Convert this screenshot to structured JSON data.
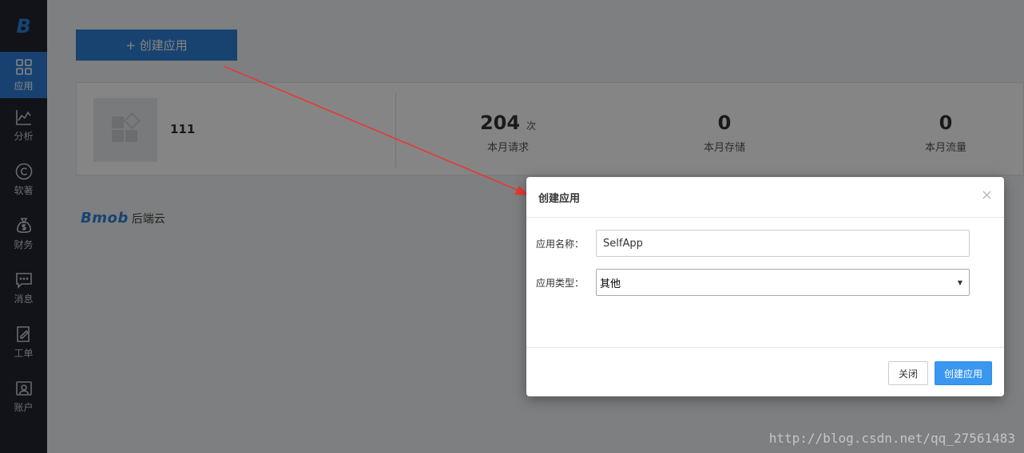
{
  "sidebar": {
    "logo": "B",
    "items": [
      {
        "label": "应用",
        "icon": "grid-icon",
        "active": true
      },
      {
        "label": "分析",
        "icon": "chart-icon",
        "active": false
      },
      {
        "label": "软著",
        "icon": "copyright-icon",
        "active": false
      },
      {
        "label": "财务",
        "icon": "money-bag-icon",
        "active": false
      },
      {
        "label": "消息",
        "icon": "message-icon",
        "active": false
      },
      {
        "label": "工单",
        "icon": "edit-icon",
        "active": false
      },
      {
        "label": "账户",
        "icon": "account-icon",
        "active": false
      }
    ]
  },
  "main": {
    "create_button": "+ 创建应用",
    "app": {
      "name": "111",
      "stats": [
        {
          "value": "204",
          "unit": "次",
          "label": "本月请求"
        },
        {
          "value": "0",
          "unit": "",
          "label": "本月存储"
        },
        {
          "value": "0",
          "unit": "",
          "label": "本月流量"
        }
      ]
    },
    "brand": {
      "logo": "Bmob",
      "text": "后端云"
    }
  },
  "modal": {
    "title": "创建应用",
    "close_symbol": "×",
    "name_label": "应用名称：",
    "name_value": "SelfApp",
    "type_label": "应用类型：",
    "type_value": "其他",
    "close_button": "关闭",
    "create_button": "创建应用"
  },
  "watermark": "http://blog.csdn.net/qq_27561483",
  "colors": {
    "accent": "#2f80d8",
    "sidebar": "#23262e",
    "arrow": "#e53935"
  }
}
